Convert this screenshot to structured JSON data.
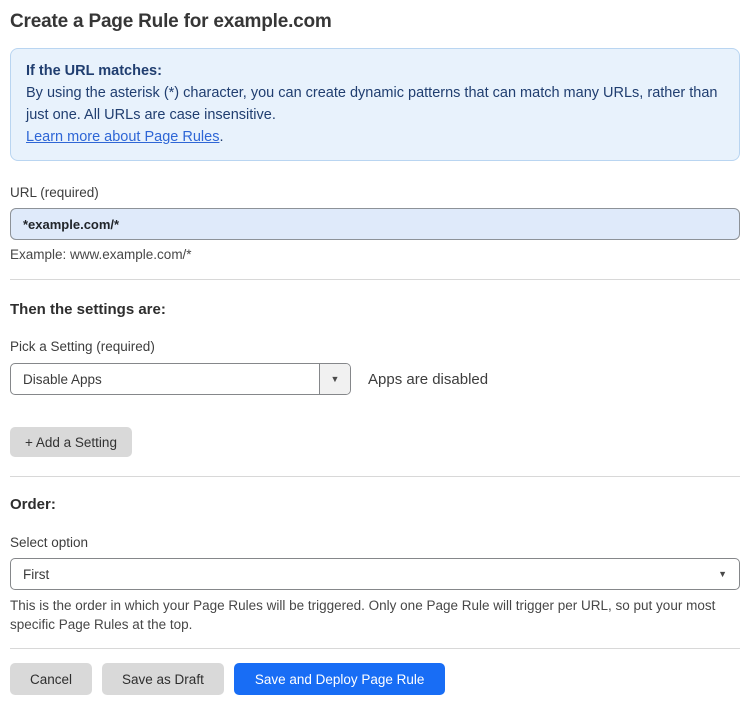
{
  "page": {
    "title": "Create a Page Rule for example.com"
  },
  "info_box": {
    "heading": "If the URL matches:",
    "body": "By using the asterisk (*) character, you can create dynamic patterns that can match many URLs, rather than just one. All URLs are case insensitive.",
    "link_label": "Learn more about Page Rules",
    "link_suffix": "."
  },
  "url_field": {
    "label": "URL (required)",
    "value": "*example.com/*",
    "helper": "Example: www.example.com/*"
  },
  "settings_section": {
    "heading": "Then the settings are:",
    "setting_label": "Pick a Setting (required)",
    "setting_value": "Disable Apps",
    "setting_status": "Apps are disabled",
    "add_setting_label": "+ Add a Setting"
  },
  "order_section": {
    "heading": "Order:",
    "label": "Select option",
    "value": "First",
    "helper": "This is the order in which your Page Rules will be triggered. Only one Page Rule will trigger per URL, so put your most specific Page Rules at the top."
  },
  "actions": {
    "cancel_label": "Cancel",
    "save_draft_label": "Save as Draft",
    "save_deploy_label": "Save and Deploy Page Rule"
  },
  "icons": {
    "dropdown_arrow": "▼"
  },
  "colors": {
    "accent_blue": "#186df5",
    "info_background": "#e8f2fc",
    "info_border": "#b9d5f1",
    "info_text": "#203e70",
    "link_blue": "#2e66d6",
    "input_background": "#dfeafa",
    "button_gray": "#d9d9d9"
  }
}
